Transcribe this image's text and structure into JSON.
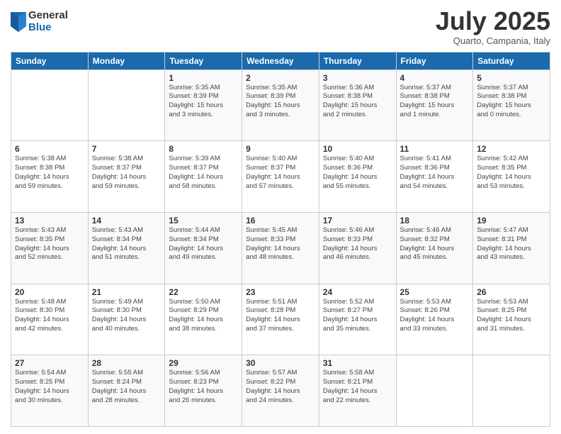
{
  "logo": {
    "general": "General",
    "blue": "Blue"
  },
  "header": {
    "month": "July 2025",
    "location": "Quarto, Campania, Italy"
  },
  "weekdays": [
    "Sunday",
    "Monday",
    "Tuesday",
    "Wednesday",
    "Thursday",
    "Friday",
    "Saturday"
  ],
  "weeks": [
    [
      {
        "day": "",
        "info": ""
      },
      {
        "day": "",
        "info": ""
      },
      {
        "day": "1",
        "info": "Sunrise: 5:35 AM\nSunset: 8:39 PM\nDaylight: 15 hours\nand 3 minutes."
      },
      {
        "day": "2",
        "info": "Sunrise: 5:35 AM\nSunset: 8:39 PM\nDaylight: 15 hours\nand 3 minutes."
      },
      {
        "day": "3",
        "info": "Sunrise: 5:36 AM\nSunset: 8:38 PM\nDaylight: 15 hours\nand 2 minutes."
      },
      {
        "day": "4",
        "info": "Sunrise: 5:37 AM\nSunset: 8:38 PM\nDaylight: 15 hours\nand 1 minute."
      },
      {
        "day": "5",
        "info": "Sunrise: 5:37 AM\nSunset: 8:38 PM\nDaylight: 15 hours\nand 0 minutes."
      }
    ],
    [
      {
        "day": "6",
        "info": "Sunrise: 5:38 AM\nSunset: 8:38 PM\nDaylight: 14 hours\nand 59 minutes."
      },
      {
        "day": "7",
        "info": "Sunrise: 5:38 AM\nSunset: 8:37 PM\nDaylight: 14 hours\nand 59 minutes."
      },
      {
        "day": "8",
        "info": "Sunrise: 5:39 AM\nSunset: 8:37 PM\nDaylight: 14 hours\nand 58 minutes."
      },
      {
        "day": "9",
        "info": "Sunrise: 5:40 AM\nSunset: 8:37 PM\nDaylight: 14 hours\nand 57 minutes."
      },
      {
        "day": "10",
        "info": "Sunrise: 5:40 AM\nSunset: 8:36 PM\nDaylight: 14 hours\nand 55 minutes."
      },
      {
        "day": "11",
        "info": "Sunrise: 5:41 AM\nSunset: 8:36 PM\nDaylight: 14 hours\nand 54 minutes."
      },
      {
        "day": "12",
        "info": "Sunrise: 5:42 AM\nSunset: 8:35 PM\nDaylight: 14 hours\nand 53 minutes."
      }
    ],
    [
      {
        "day": "13",
        "info": "Sunrise: 5:43 AM\nSunset: 8:35 PM\nDaylight: 14 hours\nand 52 minutes."
      },
      {
        "day": "14",
        "info": "Sunrise: 5:43 AM\nSunset: 8:34 PM\nDaylight: 14 hours\nand 51 minutes."
      },
      {
        "day": "15",
        "info": "Sunrise: 5:44 AM\nSunset: 8:34 PM\nDaylight: 14 hours\nand 49 minutes."
      },
      {
        "day": "16",
        "info": "Sunrise: 5:45 AM\nSunset: 8:33 PM\nDaylight: 14 hours\nand 48 minutes."
      },
      {
        "day": "17",
        "info": "Sunrise: 5:46 AM\nSunset: 8:33 PM\nDaylight: 14 hours\nand 46 minutes."
      },
      {
        "day": "18",
        "info": "Sunrise: 5:46 AM\nSunset: 8:32 PM\nDaylight: 14 hours\nand 45 minutes."
      },
      {
        "day": "19",
        "info": "Sunrise: 5:47 AM\nSunset: 8:31 PM\nDaylight: 14 hours\nand 43 minutes."
      }
    ],
    [
      {
        "day": "20",
        "info": "Sunrise: 5:48 AM\nSunset: 8:30 PM\nDaylight: 14 hours\nand 42 minutes."
      },
      {
        "day": "21",
        "info": "Sunrise: 5:49 AM\nSunset: 8:30 PM\nDaylight: 14 hours\nand 40 minutes."
      },
      {
        "day": "22",
        "info": "Sunrise: 5:50 AM\nSunset: 8:29 PM\nDaylight: 14 hours\nand 38 minutes."
      },
      {
        "day": "23",
        "info": "Sunrise: 5:51 AM\nSunset: 8:28 PM\nDaylight: 14 hours\nand 37 minutes."
      },
      {
        "day": "24",
        "info": "Sunrise: 5:52 AM\nSunset: 8:27 PM\nDaylight: 14 hours\nand 35 minutes."
      },
      {
        "day": "25",
        "info": "Sunrise: 5:53 AM\nSunset: 8:26 PM\nDaylight: 14 hours\nand 33 minutes."
      },
      {
        "day": "26",
        "info": "Sunrise: 5:53 AM\nSunset: 8:25 PM\nDaylight: 14 hours\nand 31 minutes."
      }
    ],
    [
      {
        "day": "27",
        "info": "Sunrise: 5:54 AM\nSunset: 8:25 PM\nDaylight: 14 hours\nand 30 minutes."
      },
      {
        "day": "28",
        "info": "Sunrise: 5:55 AM\nSunset: 8:24 PM\nDaylight: 14 hours\nand 28 minutes."
      },
      {
        "day": "29",
        "info": "Sunrise: 5:56 AM\nSunset: 8:23 PM\nDaylight: 14 hours\nand 26 minutes."
      },
      {
        "day": "30",
        "info": "Sunrise: 5:57 AM\nSunset: 8:22 PM\nDaylight: 14 hours\nand 24 minutes."
      },
      {
        "day": "31",
        "info": "Sunrise: 5:58 AM\nSunset: 8:21 PM\nDaylight: 14 hours\nand 22 minutes."
      },
      {
        "day": "",
        "info": ""
      },
      {
        "day": "",
        "info": ""
      }
    ]
  ]
}
